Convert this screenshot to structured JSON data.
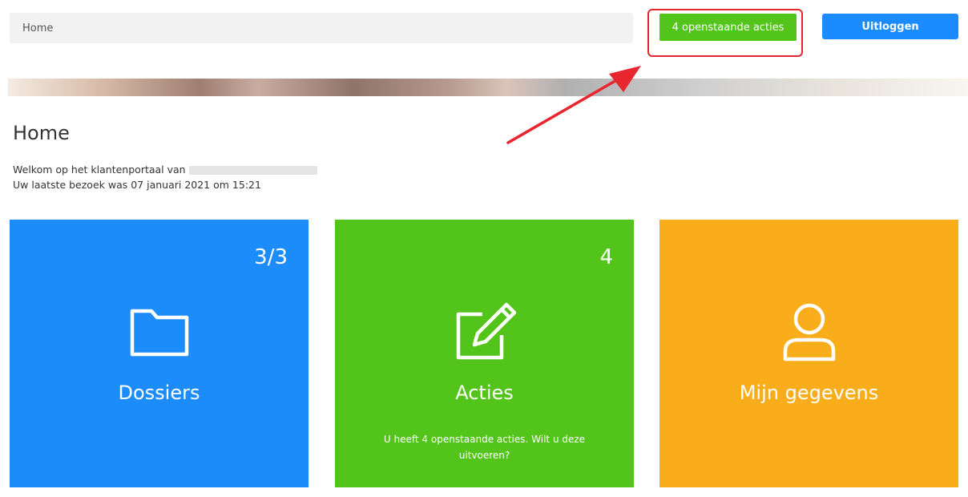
{
  "header": {
    "breadcrumb": "Home",
    "actions_button": "4 openstaande acties",
    "logout_button": "Uitloggen"
  },
  "page": {
    "title": "Home",
    "welcome_line": "Welkom op het klantenportaal van",
    "last_visit_line": "Uw laatste bezoek was 07 januari 2021 om 15:21"
  },
  "tiles": [
    {
      "title": "Dossiers",
      "count": "3/3",
      "icon": "folder-icon",
      "color": "#1c8cfb"
    },
    {
      "title": "Acties",
      "count": "4",
      "icon": "edit-icon",
      "description": "U heeft 4 openstaande acties. Wilt u deze uitvoeren?",
      "color": "#52c41a"
    },
    {
      "title": "Mijn gegevens",
      "icon": "user-icon",
      "color": "#f9ad1a"
    }
  ],
  "colors": {
    "annotation": "#e8262e",
    "logout": "#1a8cff"
  }
}
